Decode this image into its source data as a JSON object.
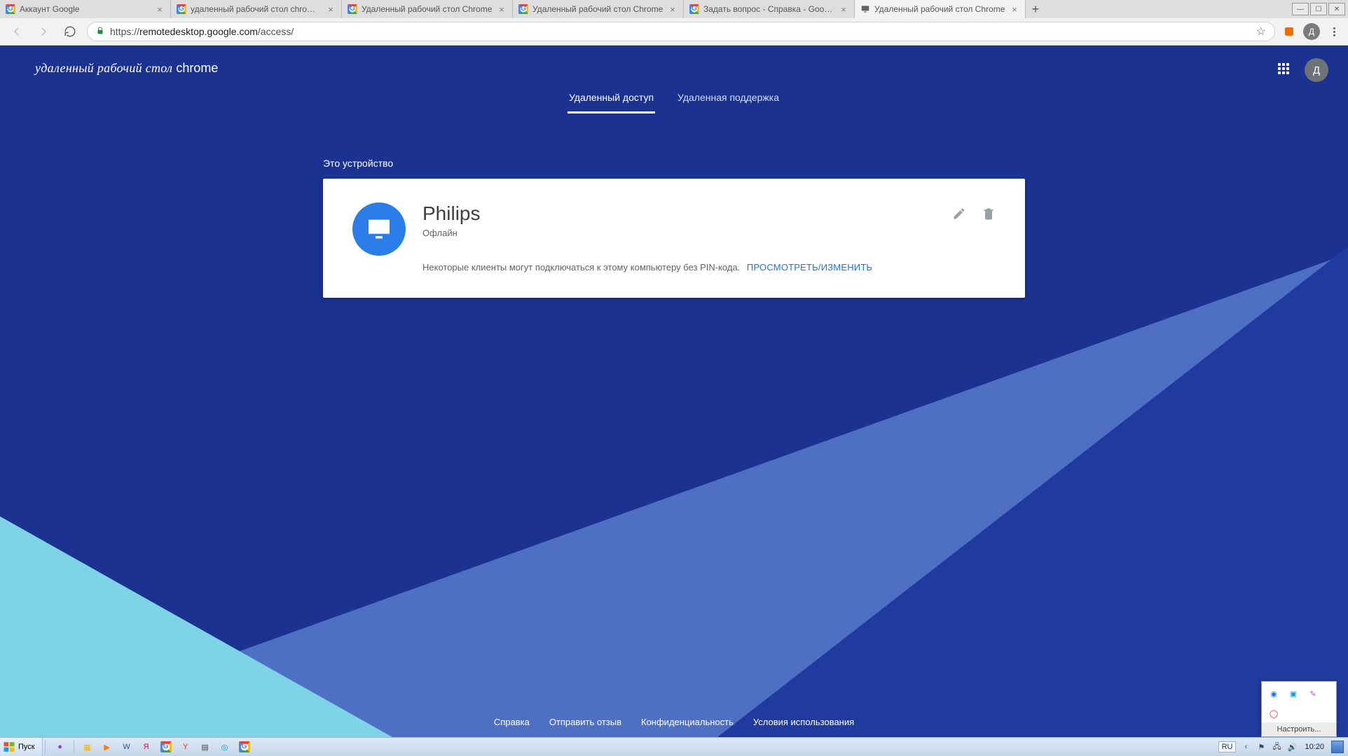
{
  "browser": {
    "tabs": [
      {
        "label": "Аккаунт Google",
        "favicon": "google"
      },
      {
        "label": "удаленный рабочий стол chrome с",
        "favicon": "google"
      },
      {
        "label": "Удаленный рабочий стол Chrome",
        "favicon": "google"
      },
      {
        "label": "Удаленный рабочий стол Chrome",
        "favicon": "google"
      },
      {
        "label": "Задать вопрос - Справка - Google",
        "favicon": "google"
      },
      {
        "label": "Удаленный рабочий стол Chrome",
        "favicon": "crd",
        "active": true
      }
    ],
    "url_proto": "https://",
    "url_host": "remotedesktop.google.com",
    "url_path": "/access/",
    "profile_initial": "Д"
  },
  "header": {
    "brand_prefix": "удаленный рабочий стол",
    "brand_chrome": "chrome",
    "tab_access": "Удаленный доступ",
    "tab_support": "Удаленная поддержка",
    "avatar_initial": "Д"
  },
  "content": {
    "section_label": "Это устройство",
    "device_name": "Philips",
    "device_status": "Офлайн",
    "note_text": "Некоторые клиенты могут подключаться к этому компьютеру без PIN-кода.",
    "note_link": "ПРОСМОТРЕТЬ/ИЗМЕНИТЬ"
  },
  "footer": {
    "help": "Справка",
    "feedback": "Отправить отзыв",
    "privacy": "Конфиденциальность",
    "terms": "Условия использования"
  },
  "notifier": {
    "button": "Настроить..."
  },
  "taskbar": {
    "start": "Пуск",
    "lang": "RU",
    "clock": "10:20"
  }
}
